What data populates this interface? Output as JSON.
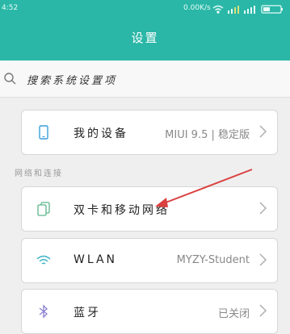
{
  "status_bar": {
    "time": "4:52",
    "speed": "0.00K/s"
  },
  "header": {
    "title": "设置"
  },
  "search": {
    "placeholder": "搜索系统设置项"
  },
  "device_row": {
    "label": "我的设备",
    "value": "MIUI 9.5 | 稳定版"
  },
  "section": {
    "network_title": "网络和连接"
  },
  "network_rows": [
    {
      "label": "双卡和移动网络",
      "value": ""
    },
    {
      "label": "WLAN",
      "value": "MYZY-Student"
    },
    {
      "label": "蓝牙",
      "value": "已关闭"
    }
  ],
  "colors": {
    "header_bg": "#2ab7a7",
    "annotation_arrow": "#d9403f"
  }
}
